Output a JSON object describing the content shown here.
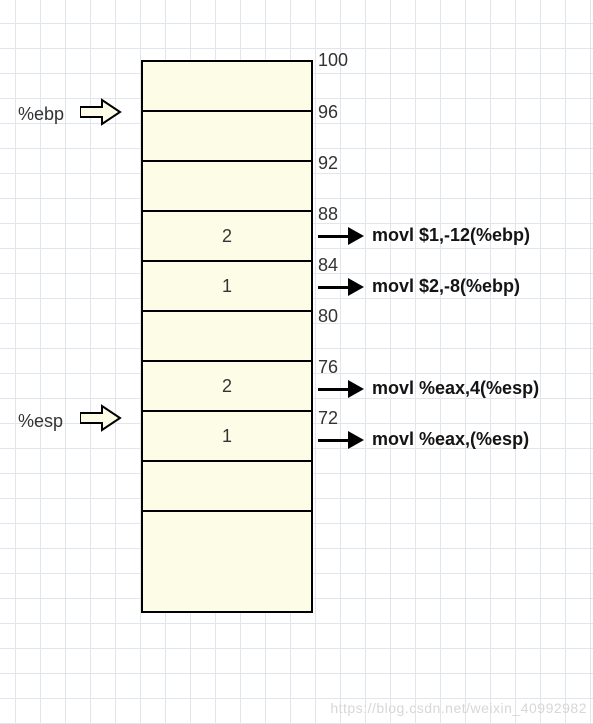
{
  "registers": {
    "ebp_label": "%ebp",
    "esp_label": "%esp"
  },
  "addresses": {
    "a100": "100",
    "a96": "96",
    "a92": "92",
    "a88": "88",
    "a84": "84",
    "a80": "80",
    "a76": "76",
    "a72": "72"
  },
  "stack_values": {
    "v_addr88_84": "2",
    "v_addr84_80": "1",
    "v_addr76_72": "2",
    "v_addr72_68": "1"
  },
  "instructions": {
    "i_at88": "movl $1,-12(%ebp)",
    "i_at84": "movl $2,-8(%ebp)",
    "i_at76": "movl %eax,4(%esp)",
    "i_at72": "movl %eax,(%esp)"
  },
  "watermark": "https://blog.csdn.net/weixin_40992982",
  "chart_data": {
    "type": "diagram",
    "description": "x86 call-stack frame illustration",
    "frame_pointer": {
      "register": "%ebp",
      "address": 96
    },
    "stack_pointer": {
      "register": "%esp",
      "address": 72
    },
    "address_high": 100,
    "cells": [
      {
        "top_addr": 100,
        "bottom_addr": 96,
        "value": null
      },
      {
        "top_addr": 96,
        "bottom_addr": 92,
        "value": null
      },
      {
        "top_addr": 92,
        "bottom_addr": 88,
        "value": null
      },
      {
        "top_addr": 88,
        "bottom_addr": 84,
        "value": 2,
        "annotation": "movl $1,-12(%ebp)"
      },
      {
        "top_addr": 84,
        "bottom_addr": 80,
        "value": 1,
        "annotation": "movl $2,-8(%ebp)"
      },
      {
        "top_addr": 80,
        "bottom_addr": 76,
        "value": null
      },
      {
        "top_addr": 76,
        "bottom_addr": 72,
        "value": 2,
        "annotation": "movl %eax,4(%esp)"
      },
      {
        "top_addr": 72,
        "bottom_addr": 68,
        "value": 1,
        "annotation": "movl %eax,(%esp)"
      }
    ]
  }
}
